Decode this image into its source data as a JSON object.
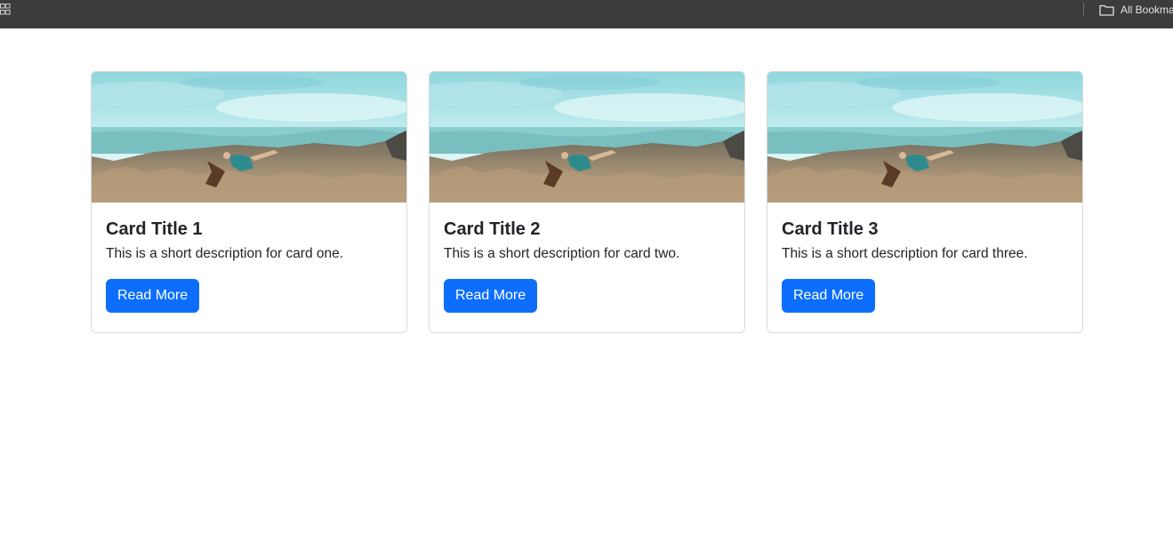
{
  "bookmarks_bar": {
    "apps_icon": "apps-grid-icon",
    "folder_icon": "folder-icon",
    "folder_label": "All Bookma"
  },
  "cards": [
    {
      "image": "cliff-climber-image",
      "title": "Card Title 1",
      "description": "This is a short description for card one.",
      "button_label": "Read More"
    },
    {
      "image": "cliff-climber-image",
      "title": "Card Title 2",
      "description": "This is a short description for card two.",
      "button_label": "Read More"
    },
    {
      "image": "cliff-climber-image",
      "title": "Card Title 3",
      "description": "This is a short description for card three.",
      "button_label": "Read More"
    }
  ],
  "colors": {
    "bar_background": "#3c3c3c",
    "button_primary": "#0d6efd",
    "card_border": "#d7d9dc",
    "text": "#212529"
  }
}
